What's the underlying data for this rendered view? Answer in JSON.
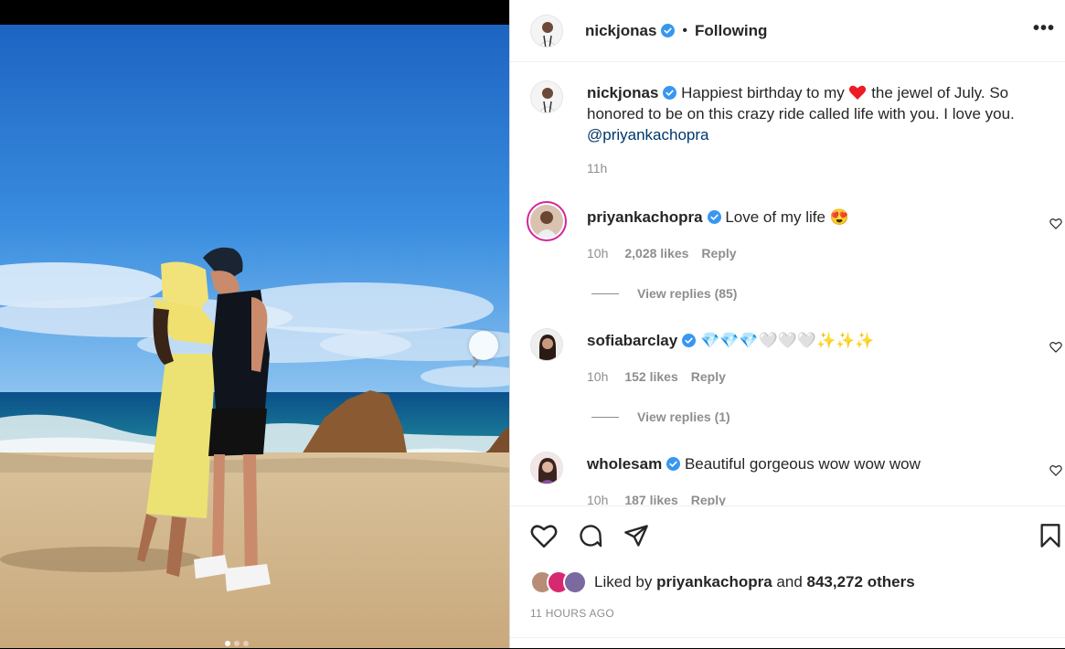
{
  "post": {
    "author": "nickjonas",
    "follow_status": "Following",
    "separator": "•",
    "more_label": "•••"
  },
  "caption": {
    "username": "nickjonas",
    "text_before": "Happiest birthday to my ",
    "text_after": " the jewel of July. So honored to be on this crazy ride called life with you. I love you.",
    "mention": "@priyankachopra",
    "time": "11h"
  },
  "comments": [
    {
      "username": "priyankachopra",
      "text": "Love of my life 😍",
      "time": "10h",
      "likes": "2,028 likes",
      "reply": "Reply",
      "view_replies": "View replies (85)"
    },
    {
      "username": "sofiabarclay",
      "text": "💎💎💎🤍🤍🤍✨✨✨",
      "time": "10h",
      "likes": "152 likes",
      "reply": "Reply",
      "view_replies": "View replies (1)"
    },
    {
      "username": "wholesam",
      "text": "Beautiful gorgeous wow wow wow",
      "time": "10h",
      "likes": "187 likes",
      "reply": "Reply"
    }
  ],
  "footer": {
    "liked_by_prefix": "Liked by",
    "liked_by_user": "priyankachopra",
    "and": "and",
    "others": "843,272 others",
    "time_ago": "11 HOURS AGO"
  },
  "icons": {
    "verified": "verified-badge",
    "like": "heart-icon",
    "comment": "comment-icon",
    "share": "share-icon",
    "save": "bookmark-icon",
    "next": "chevron-right-icon"
  },
  "colors": {
    "verified": "#3897f0",
    "mention": "#00376b",
    "muted": "#8e8e8e",
    "heart_emoji": "#ed1c24"
  }
}
